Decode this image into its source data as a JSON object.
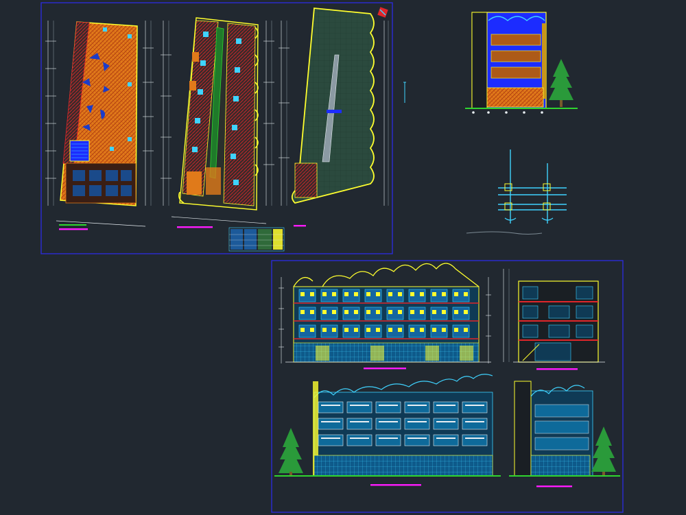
{
  "viewport": {
    "background": "#212830"
  },
  "colors": {
    "frame": "#2b2bd6",
    "wall": "#ffff2e",
    "floor": "#e07a1a",
    "hatch": "#c84a12",
    "cyan": "#3fd3ff",
    "deep_blue": "#1c2cff",
    "green": "#2fd52f",
    "tree": "#2a9a3a",
    "red": "#e0262a",
    "magenta": "#ff1aff",
    "white": "#e8eef2",
    "grey": "#7c8a93"
  },
  "sheets": [
    {
      "id": "floor-plans-sheet",
      "content": [
        "plan-first-floor",
        "plan-typical-floor",
        "plan-roof"
      ]
    },
    {
      "id": "details-area",
      "content": [
        "front-elevation-small",
        "wall-section-detail"
      ]
    },
    {
      "id": "elevations-sheet",
      "content": [
        "elevation-front",
        "section-lateral",
        "elevation-rear",
        "elevation-side"
      ]
    }
  ]
}
